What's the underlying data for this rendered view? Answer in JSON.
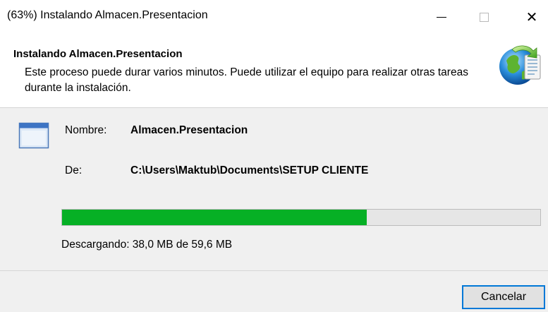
{
  "window": {
    "title": "(63%) Instalando Almacen.Presentacion",
    "controls": {
      "minimize": "minimize-icon",
      "maximize": "maximize-icon",
      "close": "close-icon",
      "close_glyph": "✕"
    }
  },
  "header": {
    "title": "Instalando Almacen.Presentacion",
    "description": "Este proceso puede durar varios minutos. Puede utilizar el equipo para realizar otras tareas durante la instalación.",
    "icon": "globe-install-icon"
  },
  "details": {
    "icon": "application-window-icon",
    "name_label": "Nombre:",
    "name_value": "Almacen.Presentacion",
    "from_label": "De:",
    "from_value": "C:\\Users\\Maktub\\Documents\\SETUP CLIENTE"
  },
  "progress": {
    "fraction": 0.6376,
    "status": "Descargando: 38,0 MB de 59,6 MB",
    "fill_color": "#06b025",
    "track_color": "#e6e6e6"
  },
  "footer": {
    "cancel_label": "Cancelar",
    "accent_color": "#0078d7"
  }
}
